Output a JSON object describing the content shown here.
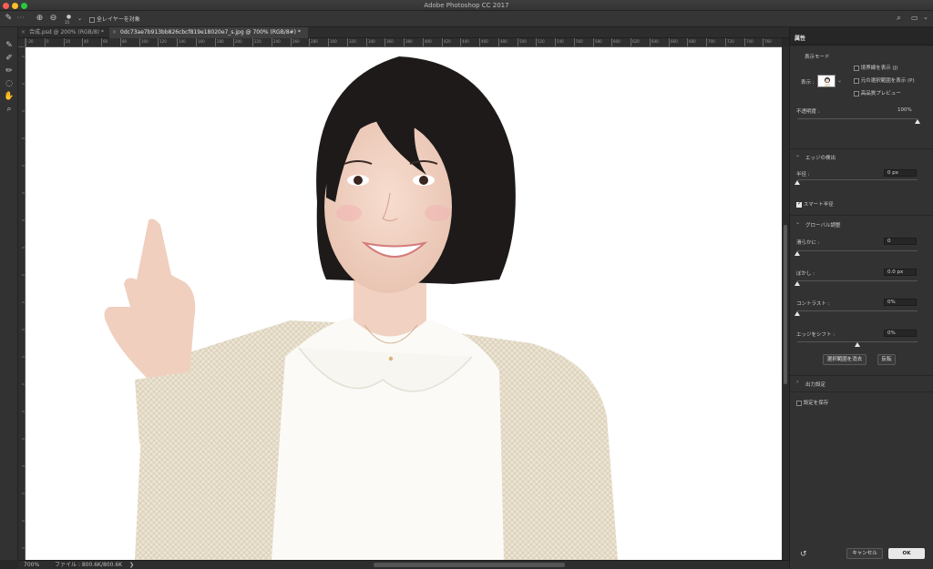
{
  "window": {
    "title": "Adobe Photoshop CC 2017"
  },
  "options_bar": {
    "brush_size": "15",
    "sample_all_layers_label": "全レイヤーを対象",
    "sample_all_layers_checked": false
  },
  "tabs": [
    {
      "label": "合成.psd @ 200% (RGB/8) *",
      "active": false
    },
    {
      "label": "0dc73ae7b913bb826cbcf819e18020e7_s.jpg @ 700% (RGB/8#) *",
      "active": true
    }
  ],
  "ruler_labels": [
    "-20",
    "0",
    "20",
    "40",
    "60",
    "80",
    "100",
    "120",
    "140",
    "160",
    "180",
    "200",
    "220",
    "240",
    "260",
    "280",
    "300",
    "320",
    "340",
    "360",
    "380",
    "400",
    "420",
    "440",
    "460",
    "480",
    "500",
    "520",
    "540",
    "560",
    "580",
    "600",
    "620",
    "640",
    "660",
    "680",
    "700",
    "720",
    "740",
    "760"
  ],
  "status": {
    "zoom": "700%",
    "file": "ファイル : 800.6K/800.6K",
    "arrow": "❯"
  },
  "panel": {
    "tab_label": "属性",
    "view_mode": {
      "heading": "表示モード",
      "view_label": "表示 :",
      "options": [
        {
          "label": "境界線を表示 (J)",
          "checked": false
        },
        {
          "label": "元の選択範囲を表示 (P)",
          "checked": false
        },
        {
          "label": "高品質プレビュー",
          "checked": false
        }
      ]
    },
    "opacity": {
      "label": "不透明度 :",
      "value": "100%",
      "level": 1.0
    },
    "edge_detection": {
      "heading": "エッジの検出",
      "radius_label": "半径 :",
      "radius_value": "0 px",
      "radius_level": 0.0,
      "smart_radius_label": "スマート半径",
      "smart_radius_checked": true
    },
    "global_refinements": {
      "heading": "グローバル調整",
      "smooth_label": "滑らかに :",
      "smooth_value": "0",
      "smooth_level": 0.0,
      "feather_label": "ぼかし :",
      "feather_value": "0.0 px",
      "feather_level": 0.0,
      "contrast_label": "コントラスト :",
      "contrast_value": "0%",
      "contrast_level": 0.0,
      "shift_label": "エッジをシフト :",
      "shift_value": "0%",
      "shift_level": 0.5,
      "clear_selection_label": "選択範囲を消去",
      "invert_label": "反転"
    },
    "output": {
      "heading": "出力設定"
    },
    "remember": {
      "label": "設定を保存",
      "checked": false
    },
    "cancel_label": "キャンセル",
    "ok_label": "OK"
  },
  "colors": {
    "panel_bg": "#323232",
    "canvas_bg": "#ffffff",
    "accent": "#e8e8e8"
  }
}
